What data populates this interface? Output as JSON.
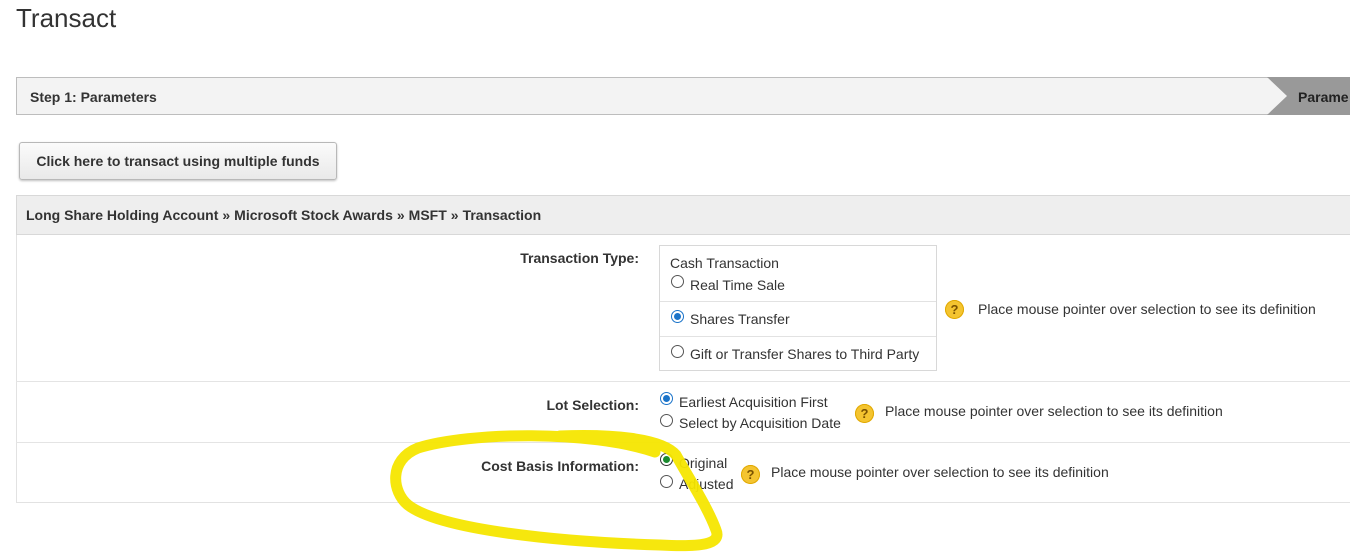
{
  "page": {
    "title": "Transact"
  },
  "steps": {
    "current": "Step 1: Parameters",
    "next": "Parame"
  },
  "multi_fund_button": "Click here to transact using multiple funds",
  "breadcrumb": [
    "Long Share Holding Account",
    "Microsoft Stock Awards",
    "MSFT",
    "Transaction"
  ],
  "breadcrumb_separator": "»",
  "transaction_type": {
    "label": "Transaction Type:",
    "group_heading": "Cash Transaction",
    "options": [
      {
        "label": "Real Time Sale",
        "selected": false
      },
      {
        "label": "Shares Transfer",
        "selected": true
      },
      {
        "label": "Gift or Transfer Shares to Third Party",
        "selected": false
      }
    ],
    "help_icon": "question-icon",
    "help": "Place mouse pointer over selection to see its definition"
  },
  "lot_selection": {
    "label": "Lot Selection:",
    "options": [
      {
        "label": "Earliest Acquisition First",
        "selected": true
      },
      {
        "label": "Select by Acquisition Date",
        "selected": false
      }
    ],
    "help_icon": "question-icon",
    "help": "Place mouse pointer over selection to see its definition"
  },
  "cost_basis": {
    "label": "Cost Basis Information:",
    "options": [
      {
        "label": "Original",
        "selected": true
      },
      {
        "label": "Adjusted",
        "selected": false
      }
    ],
    "help_icon": "question-icon",
    "help": "Place mouse pointer over selection to see its definition"
  },
  "colors": {
    "accent": "#1a73c9",
    "help_icon": "#f4c430",
    "annotation": "#f5e600",
    "step_inactive": "#999999"
  }
}
